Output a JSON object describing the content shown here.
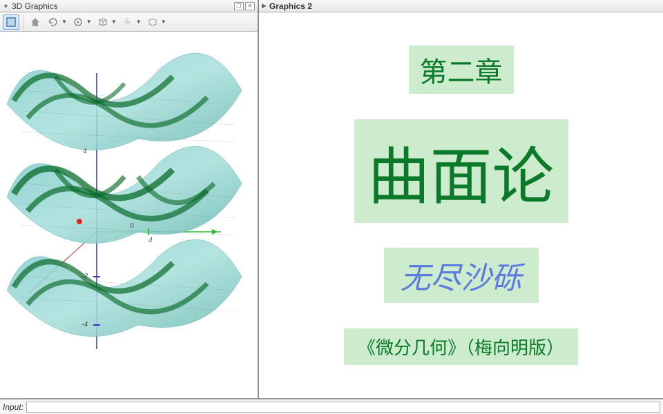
{
  "left_panel": {
    "title": "3D Graphics"
  },
  "right_panel": {
    "title": "Graphics 2"
  },
  "axis_ticks": {
    "y1": "4",
    "y2": "-2",
    "y3": "-4",
    "x1": "4",
    "x0": "0"
  },
  "content": {
    "chapter": "第二章",
    "title": "曲面论",
    "author": "无尽沙砾",
    "book": "《微分几何》（梅向明版）"
  },
  "input": {
    "label": "Input:",
    "value": ""
  }
}
